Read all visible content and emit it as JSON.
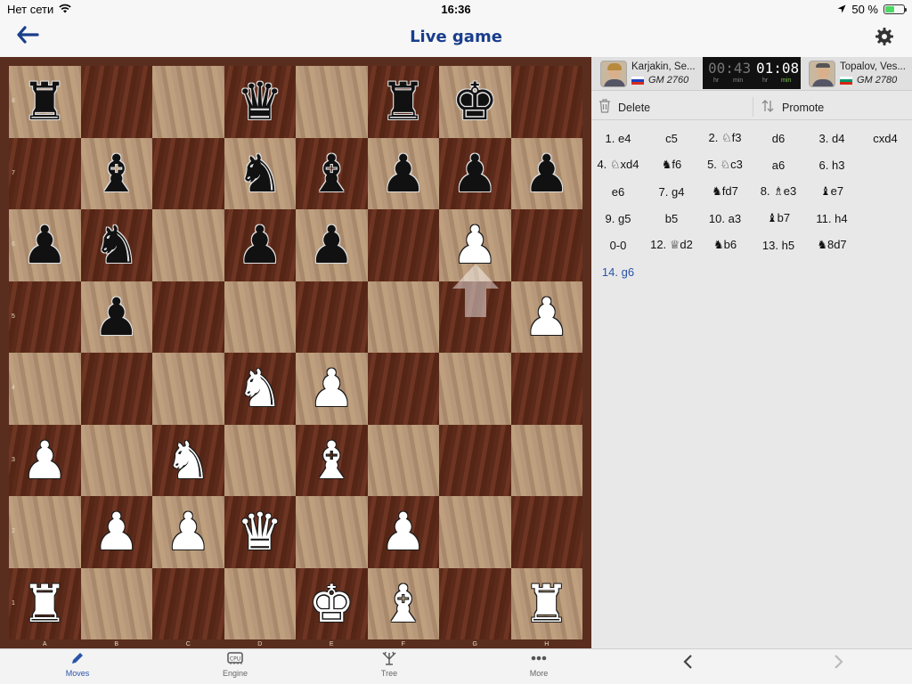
{
  "status": {
    "carrier": "Нет сети",
    "time": "16:36",
    "battery_text": "50 %",
    "battery_level": 0.5
  },
  "nav": {
    "title": "Live game"
  },
  "board": {
    "files": [
      "A",
      "B",
      "C",
      "D",
      "E",
      "F",
      "G",
      "H"
    ],
    "ranks": [
      "8",
      "7",
      "6",
      "5",
      "4",
      "3",
      "2",
      "1"
    ],
    "position": [
      [
        "bR",
        "",
        "",
        "bQ",
        "",
        "bR",
        "bK",
        ""
      ],
      [
        "",
        "bB",
        "",
        "bN",
        "bB",
        "bP",
        "bP",
        "bP"
      ],
      [
        "bP",
        "bN",
        "",
        "bP",
        "bP",
        "",
        "wP",
        ""
      ],
      [
        "",
        "bP",
        "",
        "",
        "",
        "",
        "",
        "wP"
      ],
      [
        "",
        "",
        "",
        "wN",
        "wP",
        "",
        "",
        ""
      ],
      [
        "wP",
        "",
        "wN",
        "",
        "wB",
        "",
        "",
        ""
      ],
      [
        "",
        "wP",
        "wP",
        "wQ",
        "",
        "wP",
        "",
        ""
      ],
      [
        "wR",
        "",
        "",
        "",
        "wK",
        "wB",
        "",
        "wR"
      ]
    ],
    "last_move": {
      "from": "g5",
      "to": "g6"
    }
  },
  "players": {
    "left": {
      "name": "Karjakin, Se...",
      "title_rating": "GM 2760",
      "flag": "ru"
    },
    "right": {
      "name": "Topalov, Ves...",
      "title_rating": "GM 2780",
      "flag": "bg"
    },
    "clock": {
      "left_time": "00:43",
      "right_time": "01:08",
      "unit_hr": "hr",
      "unit_min": "min"
    }
  },
  "toolbar": {
    "delete_label": "Delete",
    "promote_label": "Promote"
  },
  "moves": [
    [
      "1. e4",
      "c5",
      "2. ♘f3",
      "d6",
      "3. d4",
      "cxd4"
    ],
    [
      "4. ♘xd4",
      "♞f6",
      "5. ♘c3",
      "a6",
      "6. h3",
      ""
    ],
    [
      "e6",
      "7. g4",
      "♞fd7",
      "8. ♗e3",
      "♝e7",
      ""
    ],
    [
      "9. g5",
      "b5",
      "10. a3",
      "♝b7",
      "11. h4",
      ""
    ],
    [
      "0-0",
      "12. ♕d2",
      "♞b6",
      "13. h5",
      "♞8d7",
      ""
    ],
    [
      "14. g6",
      "",
      "",
      "",
      "",
      ""
    ]
  ],
  "current_move": "14. g6",
  "tabs": [
    {
      "label": "Moves",
      "icon": "pencil-icon"
    },
    {
      "label": "Engine",
      "icon": "cpu-icon"
    },
    {
      "label": "Tree",
      "icon": "tree-icon"
    },
    {
      "label": "More",
      "icon": "more-icon"
    }
  ],
  "colors": {
    "accent": "#2a54a8",
    "title": "#1a3e8c",
    "light_square": "#b8987a",
    "dark_square": "#5c2a1a"
  }
}
